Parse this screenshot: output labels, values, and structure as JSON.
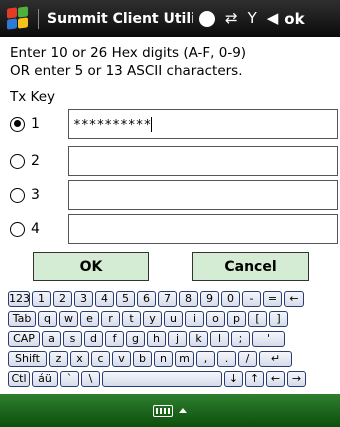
{
  "titlebar": {
    "title": "Summit Client Utili",
    "ok_label": "ok",
    "icons": [
      "windows-start-icon",
      "connection-icon",
      "signal-icon",
      "volume-icon"
    ]
  },
  "form": {
    "instruction_line1": "Enter 10 or 26 Hex digits (A-F, 0-9)",
    "instruction_line2": "OR enter 5 or 13 ASCII characters.",
    "tx_key_label": "Tx Key",
    "keys": [
      {
        "label": "1",
        "value": "**********",
        "selected": true
      },
      {
        "label": "2",
        "value": "",
        "selected": false
      },
      {
        "label": "3",
        "value": "",
        "selected": false
      },
      {
        "label": "4",
        "value": "",
        "selected": false
      }
    ]
  },
  "buttons": {
    "ok": "OK",
    "cancel": "Cancel"
  },
  "keyboard": {
    "row1": [
      "123",
      "1",
      "2",
      "3",
      "4",
      "5",
      "6",
      "7",
      "8",
      "9",
      "0",
      "-",
      "=",
      "←"
    ],
    "row2": [
      "Tab",
      "q",
      "w",
      "e",
      "r",
      "t",
      "y",
      "u",
      "i",
      "o",
      "p",
      "[",
      "]"
    ],
    "row3": [
      "CAP",
      "a",
      "s",
      "d",
      "f",
      "g",
      "h",
      "j",
      "k",
      "l",
      ";",
      "'"
    ],
    "row4": [
      "Shift",
      "z",
      "x",
      "c",
      "v",
      "b",
      "n",
      "m",
      ",",
      ".",
      "/",
      "↵"
    ],
    "row5": [
      "Ctl",
      "áü",
      "`",
      "\\",
      "",
      "↓",
      "↑",
      "←",
      "→"
    ]
  },
  "colors": {
    "button_bg": "#d4ecd4",
    "bottom_bar": "#1f6f1f",
    "key_border": "#2a3a73"
  }
}
